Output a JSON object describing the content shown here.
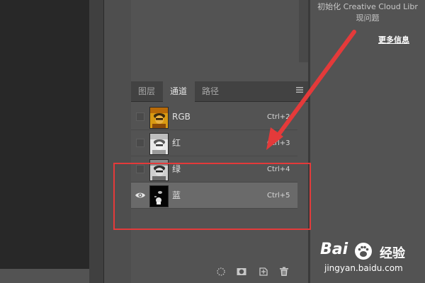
{
  "message": {
    "line1": "初始化 Creative Cloud Libraries 时出现问题",
    "line1_visible": "初始化 Creative Cloud Libr",
    "line2": "现问题",
    "more_info": "更多信息"
  },
  "panel": {
    "tabs": [
      {
        "label": "图层",
        "active": false
      },
      {
        "label": "通道",
        "active": true
      },
      {
        "label": "路径",
        "active": false
      }
    ],
    "channels": [
      {
        "name": "RGB",
        "shortcut": "Ctrl+2",
        "visible": false,
        "selected": false,
        "thumb": "rgb-thumbnail"
      },
      {
        "name": "红",
        "shortcut": "Ctrl+3",
        "visible": false,
        "selected": false,
        "thumb": "red-channel-thumbnail"
      },
      {
        "name": "绿",
        "shortcut": "Ctrl+4",
        "visible": false,
        "selected": false,
        "thumb": "green-channel-thumbnail"
      },
      {
        "name": "蓝",
        "shortcut": "Ctrl+5",
        "visible": true,
        "selected": true,
        "thumb": "blue-channel-thumbnail"
      }
    ],
    "bottom_icons": [
      "load-selection-icon",
      "save-selection-icon",
      "new-channel-icon",
      "delete-icon"
    ]
  },
  "annotation": {
    "box_color": "#e43a3a",
    "arrow_color": "#e43a3a"
  },
  "watermark": {
    "logo": "Bai",
    "logo2": "经验",
    "url": "jingyan.baidu.com"
  }
}
